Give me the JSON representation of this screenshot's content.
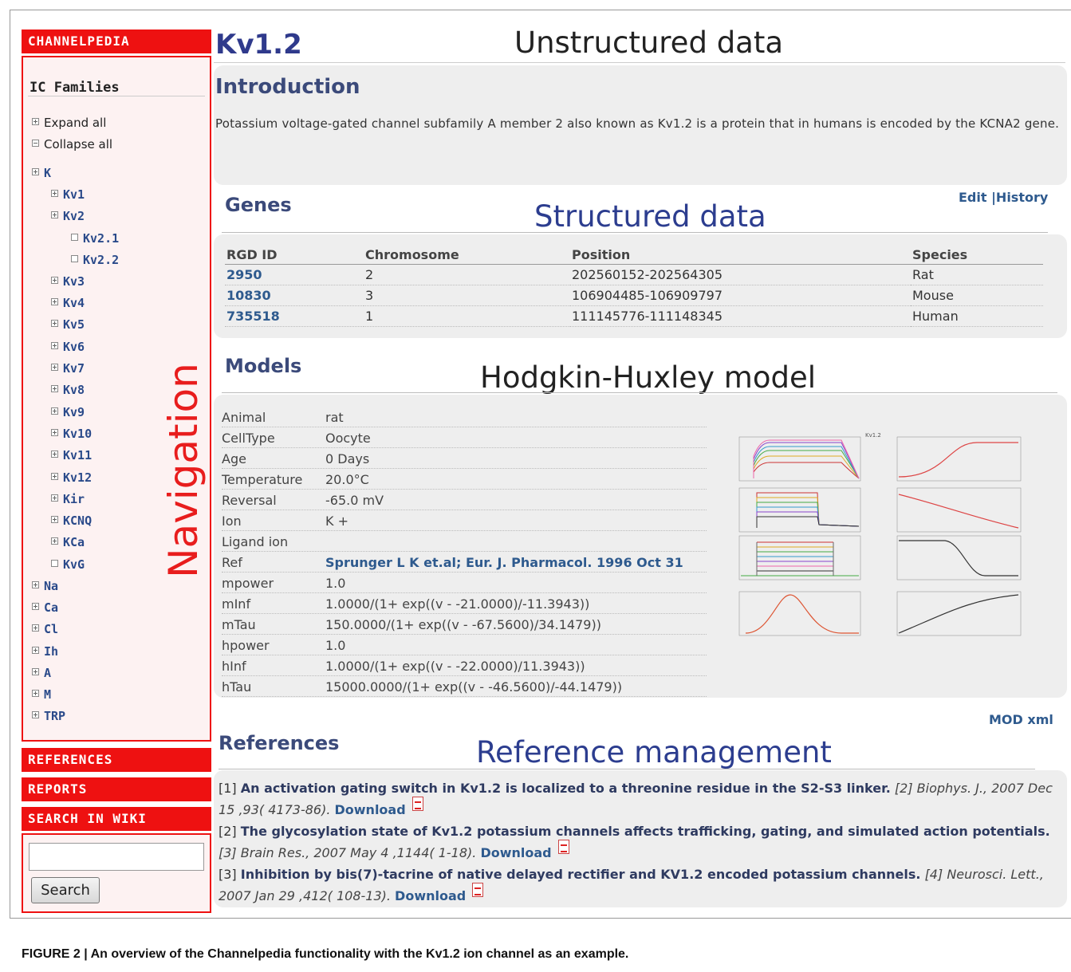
{
  "sidebar": {
    "brand": "CHANNELPEDIA",
    "families_title": "IC Families",
    "expand_all": "Expand all",
    "collapse_all": "Collapse all",
    "tree": {
      "K": "K",
      "Kv1": "Kv1",
      "Kv2": "Kv2",
      "Kv2_1": "Kv2.1",
      "Kv2_2": "Kv2.2",
      "Kv3": "Kv3",
      "Kv4": "Kv4",
      "Kv5": "Kv5",
      "Kv6": "Kv6",
      "Kv7": "Kv7",
      "Kv8": "Kv8",
      "Kv9": "Kv9",
      "Kv10": "Kv10",
      "Kv11": "Kv11",
      "Kv12": "Kv12",
      "Kir": "Kir",
      "KCNQ": "KCNQ",
      "KCa": "KCa",
      "KvG": "KvG",
      "Na": "Na",
      "Ca": "Ca",
      "Cl": "Cl",
      "Ih": "Ih",
      "A": "A",
      "M": "M",
      "TRP": "TRP"
    },
    "references": "REFERENCES",
    "reports": "REPORTS",
    "search_in_wiki": "SEARCH IN WIKI",
    "search_button": "Search",
    "search_value": ""
  },
  "annotations": {
    "navigation": "Navigation",
    "unstructured": "Unstructured data",
    "structured": "Structured data",
    "hh_model": "Hodgkin-Huxley model",
    "reference_mgmt": "Reference management"
  },
  "main": {
    "title": "Kv1.2",
    "intro_title": "Introduction",
    "intro_text": "Potassium voltage-gated channel subfamily A member 2 also known as Kv1.2 is a protein that in humans is encoded by the KCNA2 gene.",
    "genes_title": "Genes",
    "edit": "Edit |History",
    "genes_headers": [
      "RGD ID",
      "Chromosome",
      "Position",
      "Species"
    ],
    "genes_rows": [
      [
        "2950",
        "2",
        "202560152-202564305",
        "Rat"
      ],
      [
        "10830",
        "3",
        "106904485-106909797",
        "Mouse"
      ],
      [
        "735518",
        "1",
        "111145776-111148345",
        "Human"
      ]
    ],
    "models_title": "Models",
    "model_rows": [
      {
        "k": "Animal",
        "v": "rat"
      },
      {
        "k": "CellType",
        "v": "Oocyte"
      },
      {
        "k": "Age",
        "v": "0 Days"
      },
      {
        "k": "Temperature",
        "v": "20.0°C"
      },
      {
        "k": "Reversal",
        "v": "-65.0 mV"
      },
      {
        "k": "Ion",
        "v": "K +"
      },
      {
        "k": "Ligand ion",
        "v": ""
      },
      {
        "k": "Ref",
        "v": "Sprunger L K et.al; Eur. J. Pharmacol. 1996 Oct 31"
      },
      {
        "k": "mpower",
        "v": "1.0"
      },
      {
        "k": "mInf",
        "v": "1.0000/(1+ exp((v - -21.0000)/-11.3943))"
      },
      {
        "k": "mTau",
        "v": "150.0000/(1+ exp((v - -67.5600)/34.1479))"
      },
      {
        "k": "hpower",
        "v": "1.0"
      },
      {
        "k": "hInf",
        "v": "1.0000/(1+ exp((v - -22.0000)/11.3943))"
      },
      {
        "k": "hTau",
        "v": "15000.0000/(1+ exp((v - -46.5600)/-44.1479))"
      }
    ],
    "mod_xml": "MOD xml",
    "plot_title": "Kv1.2",
    "references_title": "References",
    "references": [
      {
        "num": "[1]",
        "title": "An activation gating switch in Kv1.2 is localized to a threonine residue in the S2-S3 linker.",
        "journal": "[2] Biophys. J., 2007 Dec 15 ,93( 4173-86).",
        "download": "Download"
      },
      {
        "num": "[2]",
        "title": "The glycosylation state of Kv1.2 potassium channels affects trafficking, gating, and simulated action potentials.",
        "journal": "[3] Brain Res., 2007 May 4 ,1144( 1-18).",
        "download": "Download"
      },
      {
        "num": "[3]",
        "title": "Inhibition by bis(7)-tacrine of native delayed rectifier and KV1.2 encoded potassium channels.",
        "journal": "[4] Neurosci. Lett., 2007 Jan 29 ,412( 108-13).",
        "download": "Download"
      }
    ]
  },
  "caption": "FIGURE 2 | An overview of the Channelpedia functionality with the Kv1.2 ion channel as an example.",
  "colors": {
    "accent_red": "#ee1111",
    "title_blue": "#2f3a8c",
    "link_blue": "#2e5a8e",
    "panel_gray": "#eeeeee"
  }
}
